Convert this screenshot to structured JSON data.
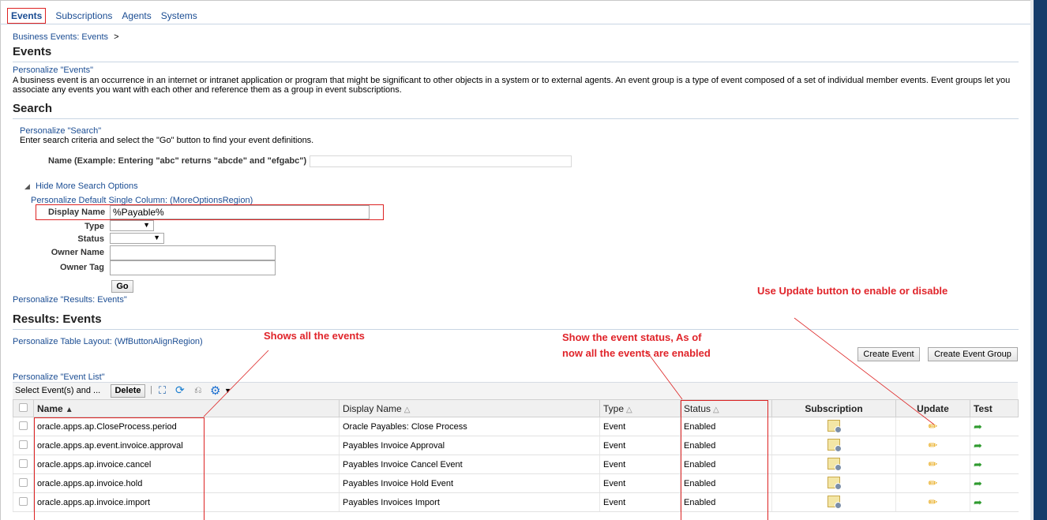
{
  "tabs": [
    "Events",
    "Subscriptions",
    "Agents",
    "Systems"
  ],
  "breadcrumb": "Business Events: Events",
  "breadcrumb_sep": ">",
  "page_title": "Events",
  "personalize_events": "Personalize \"Events\"",
  "description": "A business event is an occurrence in an internet or intranet application or program that might be significant to other objects in a system or to external agents. An event group is a type of event composed of a set of individual member events. Event groups let you associate any events you want with each other and reference them as a group in event subscriptions.",
  "search": {
    "title": "Search",
    "personalize": "Personalize \"Search\"",
    "instructions": "Enter search criteria and select the \"Go\" button to find your event definitions.",
    "name_label": "Name (Example: Entering \"abc\" returns \"abcde\" and \"efgabc\")",
    "name_value": "",
    "hide_more": "Hide More Search Options",
    "personalize_default": "Personalize Default Single Column: (MoreOptionsRegion)",
    "display_name_label": "Display Name",
    "display_name_value": "%Payable%",
    "type_label": "Type",
    "type_value": "",
    "status_label": "Status",
    "status_value": "",
    "owner_name_label": "Owner Name",
    "owner_tag_label": "Owner Tag",
    "go_button": "Go"
  },
  "personalize_results": "Personalize \"Results: Events\"",
  "results_title": "Results: Events",
  "personalize_table_layout": "Personalize Table Layout: (WfButtonAlignRegion)",
  "create_event_button": "Create Event",
  "create_event_group_button": "Create Event Group",
  "personalize_event_list": "Personalize \"Event List\"",
  "select_events_label": "Select Event(s) and ...",
  "delete_button": "Delete",
  "columns": {
    "name": "Name",
    "display_name": "Display Name",
    "type": "Type",
    "status": "Status",
    "subscription": "Subscription",
    "update": "Update",
    "test": "Test"
  },
  "rows": [
    {
      "name": "oracle.apps.ap.CloseProcess.period",
      "display_name": "Oracle Payables: Close Process",
      "type": "Event",
      "status": "Enabled"
    },
    {
      "name": "oracle.apps.ap.event.invoice.approval",
      "display_name": "Payables Invoice Approval",
      "type": "Event",
      "status": "Enabled"
    },
    {
      "name": "oracle.apps.ap.invoice.cancel",
      "display_name": "Payables Invoice Cancel Event",
      "type": "Event",
      "status": "Enabled"
    },
    {
      "name": "oracle.apps.ap.invoice.hold",
      "display_name": "Payables Invoice Hold Event",
      "type": "Event",
      "status": "Enabled"
    },
    {
      "name": "oracle.apps.ap.invoice.import",
      "display_name": "Payables Invoices Import",
      "type": "Event",
      "status": "Enabled"
    }
  ],
  "annotations": {
    "shows_all": "Shows all the events",
    "status_line1": "Show the event status, As of",
    "status_line2": "now all the events are enabled",
    "update_note": "Use Update button to enable or disable"
  }
}
